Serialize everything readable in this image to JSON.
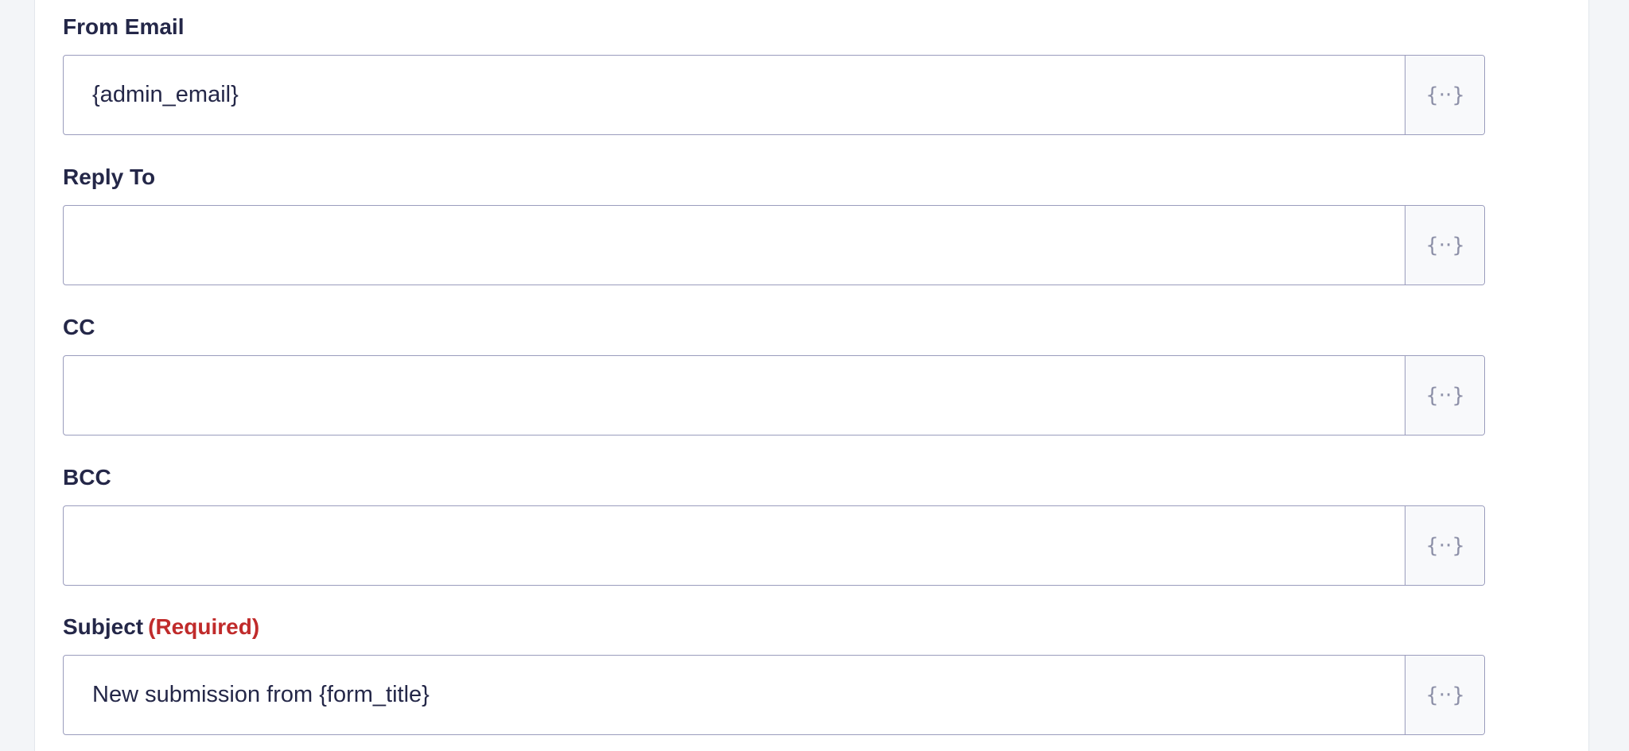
{
  "fields": [
    {
      "id": "from_email",
      "label": "From Email",
      "required_text": "",
      "value": "{admin_email}",
      "button_icon": "merge-tag-icon"
    },
    {
      "id": "reply_to",
      "label": "Reply To",
      "required_text": "",
      "value": "",
      "button_icon": "merge-tag-icon"
    },
    {
      "id": "cc",
      "label": "CC",
      "required_text": "",
      "value": "",
      "button_icon": "merge-tag-icon"
    },
    {
      "id": "bcc",
      "label": "BCC",
      "required_text": "",
      "value": "",
      "button_icon": "merge-tag-icon"
    },
    {
      "id": "subject",
      "label": "Subject",
      "required_text": "(Required)",
      "value": "New submission from {form_title}",
      "button_icon": "merge-tag-icon"
    }
  ],
  "colors": {
    "label": "#242748",
    "required": "#c02b2b",
    "border": "#9a9cbd",
    "icon": "#8d90a8",
    "page_bg": "#f3f5f8"
  }
}
